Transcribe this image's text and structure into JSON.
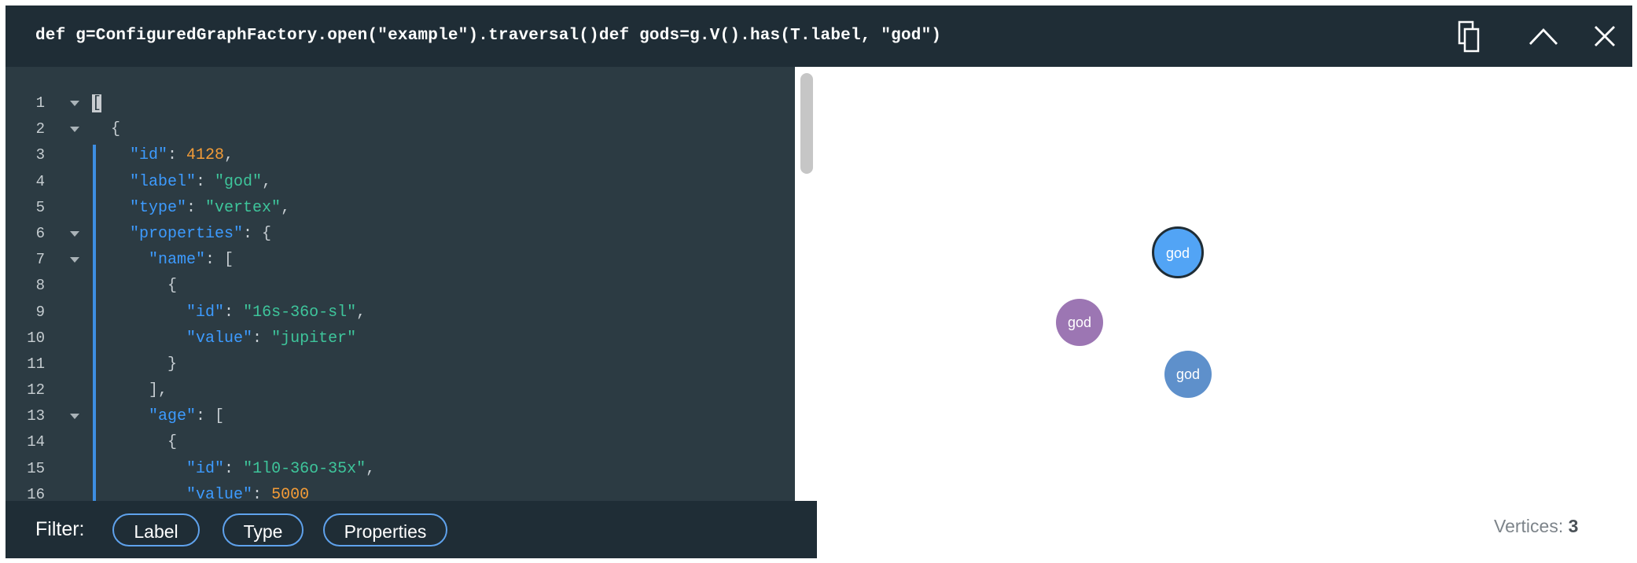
{
  "header": {
    "query": "def g=ConfiguredGraphFactory.open(\"example\").traversal()def gods=g.V().has(T.label, \"god\")",
    "icons": {
      "copy": "copy-icon",
      "collapse": "chevron-up-icon",
      "close": "close-icon"
    }
  },
  "editor": {
    "lines": [
      {
        "n": "1",
        "fold": true,
        "tokens": [
          {
            "c": "cursor",
            "t": "["
          }
        ]
      },
      {
        "n": "2",
        "fold": true,
        "tokens": [
          {
            "c": "t-p",
            "t": "  {"
          }
        ]
      },
      {
        "n": "3",
        "fold": false,
        "tokens": [
          {
            "c": "t-p",
            "t": "    "
          },
          {
            "c": "t-k",
            "t": "\"id\""
          },
          {
            "c": "t-p",
            "t": ": "
          },
          {
            "c": "t-n",
            "t": "4128"
          },
          {
            "c": "t-p",
            "t": ","
          }
        ]
      },
      {
        "n": "4",
        "fold": false,
        "tokens": [
          {
            "c": "t-p",
            "t": "    "
          },
          {
            "c": "t-k",
            "t": "\"label\""
          },
          {
            "c": "t-p",
            "t": ": "
          },
          {
            "c": "t-s",
            "t": "\"god\""
          },
          {
            "c": "t-p",
            "t": ","
          }
        ]
      },
      {
        "n": "5",
        "fold": false,
        "tokens": [
          {
            "c": "t-p",
            "t": "    "
          },
          {
            "c": "t-k",
            "t": "\"type\""
          },
          {
            "c": "t-p",
            "t": ": "
          },
          {
            "c": "t-s",
            "t": "\"vertex\""
          },
          {
            "c": "t-p",
            "t": ","
          }
        ]
      },
      {
        "n": "6",
        "fold": true,
        "tokens": [
          {
            "c": "t-p",
            "t": "    "
          },
          {
            "c": "t-k",
            "t": "\"properties\""
          },
          {
            "c": "t-p",
            "t": ": {"
          }
        ]
      },
      {
        "n": "7",
        "fold": true,
        "tokens": [
          {
            "c": "t-p",
            "t": "      "
          },
          {
            "c": "t-k",
            "t": "\"name\""
          },
          {
            "c": "t-p",
            "t": ": ["
          }
        ]
      },
      {
        "n": "8",
        "fold": false,
        "tokens": [
          {
            "c": "t-p",
            "t": "        {"
          }
        ]
      },
      {
        "n": "9",
        "fold": false,
        "tokens": [
          {
            "c": "t-p",
            "t": "          "
          },
          {
            "c": "t-k",
            "t": "\"id\""
          },
          {
            "c": "t-p",
            "t": ": "
          },
          {
            "c": "t-s",
            "t": "\"16s-36o-sl\""
          },
          {
            "c": "t-p",
            "t": ","
          }
        ]
      },
      {
        "n": "10",
        "fold": false,
        "tokens": [
          {
            "c": "t-p",
            "t": "          "
          },
          {
            "c": "t-k",
            "t": "\"value\""
          },
          {
            "c": "t-p",
            "t": ": "
          },
          {
            "c": "t-s",
            "t": "\"jupiter\""
          }
        ]
      },
      {
        "n": "11",
        "fold": false,
        "tokens": [
          {
            "c": "t-p",
            "t": "        }"
          }
        ]
      },
      {
        "n": "12",
        "fold": false,
        "tokens": [
          {
            "c": "t-p",
            "t": "      ],"
          }
        ]
      },
      {
        "n": "13",
        "fold": true,
        "tokens": [
          {
            "c": "t-p",
            "t": "      "
          },
          {
            "c": "t-k",
            "t": "\"age\""
          },
          {
            "c": "t-p",
            "t": ": ["
          }
        ]
      },
      {
        "n": "14",
        "fold": false,
        "tokens": [
          {
            "c": "t-p",
            "t": "        {"
          }
        ]
      },
      {
        "n": "15",
        "fold": false,
        "tokens": [
          {
            "c": "t-p",
            "t": "          "
          },
          {
            "c": "t-k",
            "t": "\"id\""
          },
          {
            "c": "t-p",
            "t": ": "
          },
          {
            "c": "t-s",
            "t": "\"1l0-36o-35x\""
          },
          {
            "c": "t-p",
            "t": ","
          }
        ]
      },
      {
        "n": "16",
        "fold": false,
        "tokens": [
          {
            "c": "t-p",
            "t": "          "
          },
          {
            "c": "t-k",
            "t": "\"value\""
          },
          {
            "c": "t-p",
            "t": ": "
          },
          {
            "c": "t-n",
            "t": "5000"
          }
        ]
      }
    ]
  },
  "filter": {
    "label": "Filter:",
    "chips": {
      "label": "Label",
      "type": "Type",
      "properties": "Properties"
    }
  },
  "graph": {
    "nodes": [
      {
        "label": "god",
        "color": "#52a4f5",
        "selected": true
      },
      {
        "label": "god",
        "color": "#9c76b3",
        "selected": false
      },
      {
        "label": "god",
        "color": "#5e90cb",
        "selected": false
      }
    ],
    "vertices_label": "Vertices:",
    "vertices_count": "3"
  },
  "colors": {
    "header_bg": "#1f2d36",
    "editor_bg": "#2c3b43",
    "key": "#3d9bff",
    "string": "#3ec59b",
    "number": "#f39c37",
    "accent": "#5fa2ec"
  }
}
